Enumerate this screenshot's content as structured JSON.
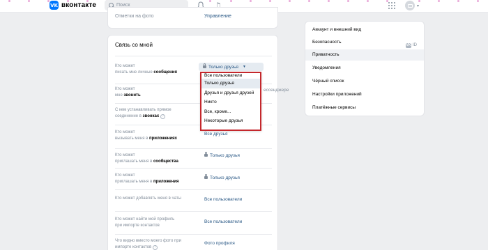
{
  "header": {
    "logo_mark": "VK",
    "logo_text": "вконтакте",
    "search_placeholder": "Поиск"
  },
  "top_card": {
    "label": "Отметки на фото",
    "value": "Управление"
  },
  "section": {
    "title": "Связь со мной",
    "rows": [
      {
        "q1": "Кто может",
        "q2_plain": "писать мне личные ",
        "q2_bold": "сообщения",
        "answer": "Только друзья"
      },
      {
        "q1": "Кто может",
        "q2_plain": "мне ",
        "q2_bold": "звонить",
        "answer": ""
      },
      {
        "q1": "С кем устанавливать прямое",
        "q2_plain": "соединение в ",
        "q2_bold": "звонках",
        "answer": ""
      },
      {
        "q1": "Кто может",
        "q2_plain": "вызывать меня в ",
        "q2_bold": "приложениях",
        "answer": "Все друзья"
      },
      {
        "q1": "Кто может",
        "q2_plain": "приглашать меня в ",
        "q2_bold": "сообщества",
        "answer": "Только друзья"
      },
      {
        "q1": "Кто может",
        "q2_plain": "приглашать меня в ",
        "q2_bold": "приложения",
        "answer": "Только друзья"
      },
      {
        "q1": "Кто может добавлять меня в чаты",
        "q2_plain": "",
        "q2_bold": "",
        "answer": "Все пользователи"
      },
      {
        "q1": "Кто может найти мой профиль",
        "q2_plain": "при импорте контактов",
        "q2_bold": "",
        "answer": "Все пользователи"
      },
      {
        "q1": "Что видно вместо моего фото при",
        "q2_plain": "импорте контактов",
        "q2_bold": "",
        "answer": "Фото профиля"
      }
    ]
  },
  "dropdown": {
    "options": [
      "Все пользователи",
      "Только друзья",
      "Друзья и друзья друзей",
      "Никто",
      "Все, кроме...",
      "Некоторые друзья"
    ],
    "selected_index": 1,
    "peek_text": "ессенджере"
  },
  "menu": {
    "items": [
      "Аккаунт и внешний вид",
      "Безопасность",
      "Приватность",
      "Уведомления",
      "Чёрный список",
      "Настройки приложений",
      "Платёжные сервисы"
    ],
    "selected_index": 2,
    "security_badge": "ID",
    "security_badge_mark": "VK"
  },
  "colors": {
    "accent": "#0077ff",
    "link": "#2a5885",
    "highlight_border": "#c4272c",
    "background": "#edeef0"
  }
}
